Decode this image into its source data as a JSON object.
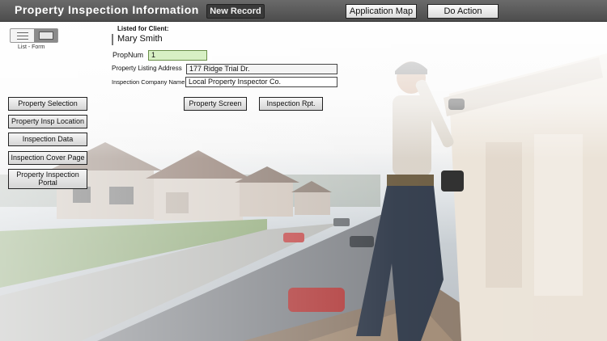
{
  "header": {
    "title": "Property Inspection Information",
    "new_record": "New Record",
    "application_map": "Application Map",
    "do_action": "Do Action"
  },
  "view_toggle": {
    "label": "List  -  Form",
    "active": "form"
  },
  "client": {
    "label": "Listed for Client:",
    "name": "Mary Smith"
  },
  "fields": {
    "prop_num_label": "PropNum",
    "prop_num_value": "1",
    "address_label": "Property Listing Address",
    "address_value": "177 Ridge Trial Dr.",
    "company_label": "Inspection Company Name",
    "company_value": "Local Property Inspector Co."
  },
  "actions": {
    "property_screen": "Property Screen",
    "inspection_rpt": "Inspection Rpt."
  },
  "sidebar": {
    "items": [
      {
        "label": "Property Selection"
      },
      {
        "label": "Property Insp Location"
      },
      {
        "label": "Inspection Data"
      },
      {
        "label": "Inspection Cover Page"
      },
      {
        "label": "Property Inspection Portal"
      }
    ]
  }
}
